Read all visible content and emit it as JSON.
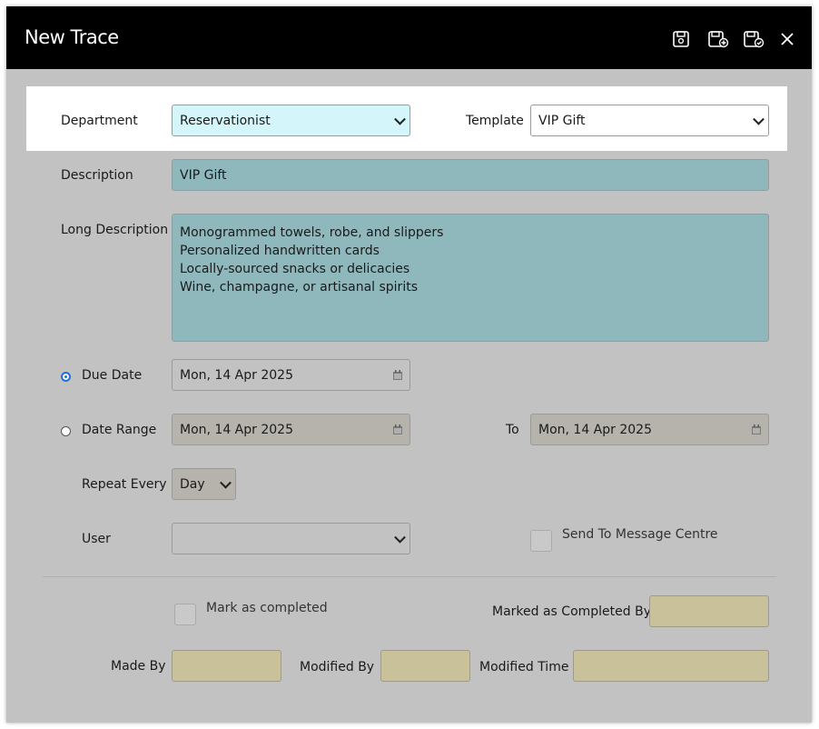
{
  "window": {
    "title": "New Trace",
    "icons": [
      "save-icon",
      "save-add-icon",
      "save-confirm-icon",
      "close-icon"
    ]
  },
  "form": {
    "department": {
      "label": "Department",
      "value": "Reservationist"
    },
    "template": {
      "label": "Template",
      "value": "VIP Gift"
    },
    "description": {
      "label": "Description",
      "value": "VIP Gift"
    },
    "long_description": {
      "label": "Long Description",
      "lines": [
        "Monogrammed towels, robe, and slippers",
        "Personalized handwritten cards",
        "Locally-sourced snacks or delicacies",
        "Wine, champagne, or artisanal spirits"
      ]
    },
    "due_date": {
      "label": "Due Date",
      "value": "Mon, 14 Apr 2025",
      "selected": true
    },
    "date_range": {
      "label": "Date Range",
      "from": "Mon, 14 Apr 2025",
      "to_label": "To",
      "to": "Mon, 14 Apr 2025",
      "selected": false
    },
    "repeat_every": {
      "label": "Repeat Every",
      "value": "Day"
    },
    "user": {
      "label": "User",
      "value": ""
    },
    "send_to_message_centre": {
      "label": "Send To Message Centre",
      "checked": false
    },
    "mark_as_completed": {
      "label": "Mark as completed",
      "checked": false
    },
    "marked_as_completed_by": {
      "label": "Marked as Completed By",
      "value": ""
    },
    "made_by": {
      "label": "Made By",
      "value": ""
    },
    "modified_by": {
      "label": "Modified By",
      "value": ""
    },
    "modified_time": {
      "label": "Modified Time",
      "value": ""
    }
  },
  "colors": {
    "titlebar": "#000000",
    "dialog_bg": "#c2c2c2",
    "selected_field": "#d4f6fa",
    "teal_field": "#8fb8bd",
    "readonly_field": "#c8c19a",
    "radio_selected": "#1a73e8"
  }
}
